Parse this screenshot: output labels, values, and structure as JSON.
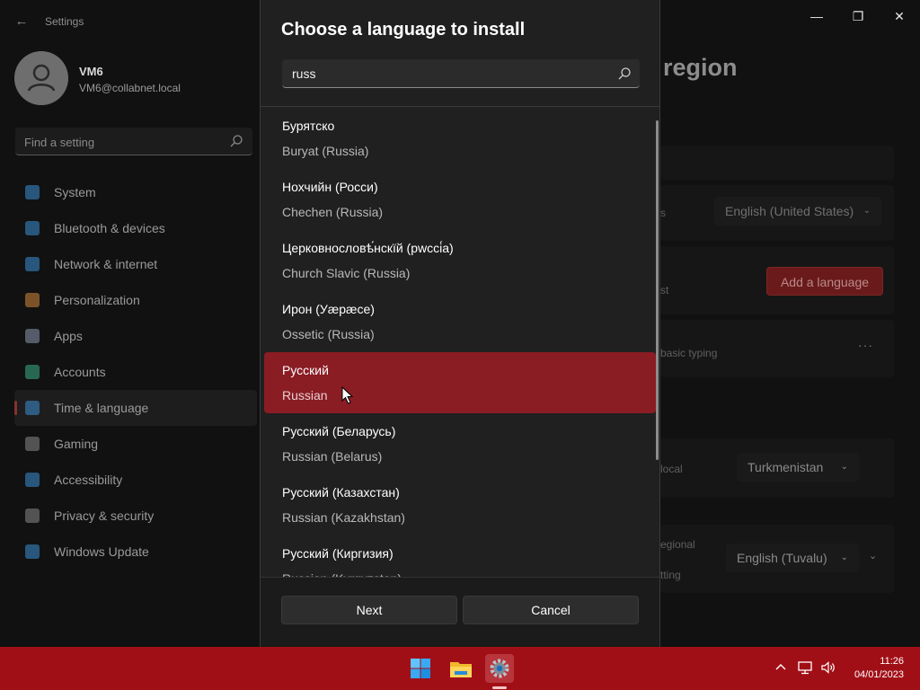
{
  "window": {
    "title": "Settings",
    "back_glyph": "←",
    "minimize_glyph": "—",
    "restore_glyph": "❐",
    "close_glyph": "✕"
  },
  "user": {
    "name": "VM6",
    "email": "VM6@collabnet.local"
  },
  "sidebar": {
    "search_placeholder": "Find a setting",
    "items": [
      {
        "label": "System",
        "icon": "system-icon",
        "color": "#3c8fd6"
      },
      {
        "label": "Bluetooth & devices",
        "icon": "bluetooth-icon",
        "color": "#3c8fd6"
      },
      {
        "label": "Network & internet",
        "icon": "network-icon",
        "color": "#3c8fd6"
      },
      {
        "label": "Personalization",
        "icon": "paintbrush-icon",
        "color": "#d68a3c"
      },
      {
        "label": "Apps",
        "icon": "apps-icon",
        "color": "#8a9ab0"
      },
      {
        "label": "Accounts",
        "icon": "accounts-icon",
        "color": "#3cb08a"
      },
      {
        "label": "Time & language",
        "icon": "time-language-icon",
        "color": "#3c8fd6",
        "active": true
      },
      {
        "label": "Gaming",
        "icon": "gaming-icon",
        "color": "#8a8a8a"
      },
      {
        "label": "Accessibility",
        "icon": "accessibility-icon",
        "color": "#3c8fd6"
      },
      {
        "label": "Privacy & security",
        "icon": "shield-icon",
        "color": "#8a8a8a"
      },
      {
        "label": "Windows Update",
        "icon": "update-icon",
        "color": "#3c8fd6"
      }
    ]
  },
  "background_page": {
    "title_fragment": "region",
    "display_language_value": "English (United States)",
    "row1_fragment": "s",
    "add_language_label": "Add a language",
    "row2_fragment": "st",
    "row3_fragment": "basic typing",
    "more_glyph": "···",
    "country_fragment": "local",
    "country_value": "Turkmenistan",
    "regional_fragment_1": "egional",
    "regional_fragment_2": "tting",
    "regional_format_value": "English (Tuvalu)",
    "chevron_glyph": "⌄"
  },
  "dialog": {
    "title": "Choose a language to install",
    "search_value": "russ",
    "languages": [
      {
        "native": "Бурятско",
        "english": "Buryat (Russia)"
      },
      {
        "native": "Нохчийн (Росси)",
        "english": "Chechen (Russia)"
      },
      {
        "native": "Церковнословѣ́нскїй (рwссі́а)",
        "english": "Church Slavic (Russia)"
      },
      {
        "native": "Ирон (Уæрæсе)",
        "english": "Ossetic (Russia)"
      },
      {
        "native": "Русский",
        "english": "Russian",
        "selected": true
      },
      {
        "native": "Русский (Беларусь)",
        "english": "Russian (Belarus)"
      },
      {
        "native": "Русский (Казахстан)",
        "english": "Russian (Kazakhstan)"
      },
      {
        "native": "Русский (Киргизия)",
        "english": "Russian (Kyrgyzstan)"
      }
    ],
    "next_label": "Next",
    "cancel_label": "Cancel"
  },
  "taskbar": {
    "time": "11:26",
    "date": "04/01/2023",
    "accent_color": "#a10f16",
    "apps": [
      "start-icon",
      "file-explorer-icon",
      "settings-app-icon"
    ],
    "tray": [
      "chevron-up-icon",
      "network-tray-icon",
      "volume-icon"
    ]
  }
}
